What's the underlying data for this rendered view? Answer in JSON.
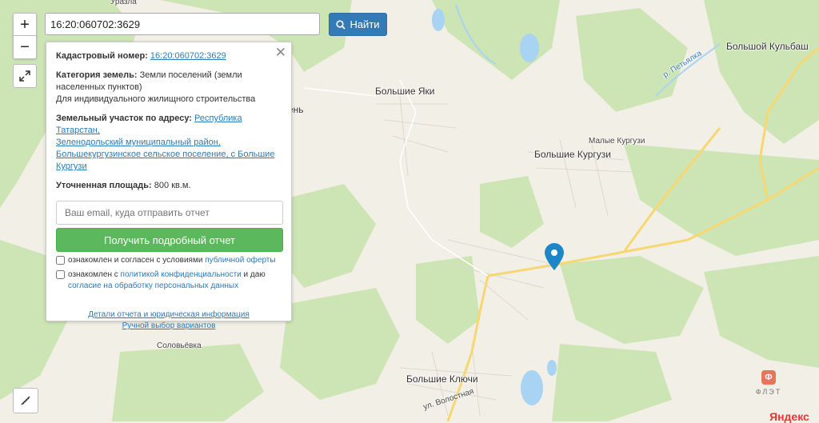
{
  "search": {
    "value": "16:20:060702:3629",
    "button_label": "Найти"
  },
  "controls": {
    "zoom_in": "+",
    "zoom_out": "−"
  },
  "panel": {
    "cadastral_label": "Кадастровый номер:",
    "cadastral_value": "16:20:060702:3629",
    "category_label": "Категория земель:",
    "category_value_line1": "Земли поселений (земли",
    "category_value_line2": "населенных пунктов)",
    "category_value_line3": "Для индивидуального жилищного строительства",
    "address_label": "Земельный участок по адресу:",
    "address_line1": "Республика Татарстан,",
    "address_line2": "Зеленодольский муниципальный район,",
    "address_line3": "Большекургузинское сельское поселение, с Большие",
    "address_line4": "Кургузи",
    "area_label": "Уточненная площадь:",
    "area_value": "800 кв.м.",
    "email_placeholder": "Ваш email, куда отправить отчет",
    "report_button": "Получить подробный отчет",
    "check1_text": "ознакомлен и согласен с условиями",
    "check1_link": "публичной оферты",
    "check2_text": "ознакомлен с",
    "check2_link": "политикой конфиденциальности",
    "check2_mid": "и даю",
    "check2_link2": "согласие на обработку персональных данных",
    "link_details": "Детали отчета и юридическая информация",
    "link_manual": "Ручной выбор вариантов"
  },
  "places": {
    "bolshie_yaki": "Большие Яки",
    "bolshoi_kulbash": "Большой Кульбаш",
    "malye_kurguzi": "Малые Кургузи",
    "bolshie_kurguzi": "Большие Кургузи",
    "solovevka": "Соловьёвка",
    "bolshie_klyuchi": "Большие Ключи",
    "ul_volostnaya": "ул. Волостная",
    "r_petyalka": "р. Петьялка",
    "partial_ven": "ень",
    "partial_urazla": "Уразла"
  },
  "branding": {
    "flat_badge": "Ф",
    "flat_text": "ФЛЭТ",
    "yandex": "Яндекс"
  },
  "colors": {
    "forest": "#cde5b4",
    "field": "#f2efe6",
    "water": "#a9d3f2",
    "road": "#f7d772",
    "marker": "#1d86c8"
  }
}
